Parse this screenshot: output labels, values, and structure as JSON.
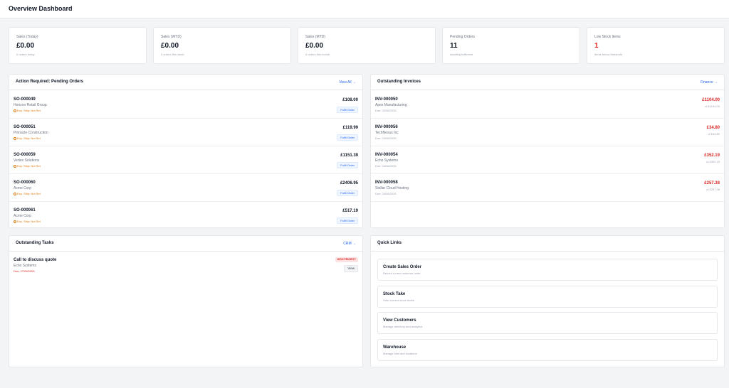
{
  "header": {
    "title": "Overview Dashboard"
  },
  "stats": [
    {
      "label": "Sales (Today)",
      "value": "£0.00",
      "sub": "0 orders today"
    },
    {
      "label": "Sales (WTD)",
      "value": "£0.00",
      "sub": "0 orders this week"
    },
    {
      "label": "Sales (MTD)",
      "value": "£0.00",
      "sub": "0 orders this month"
    },
    {
      "label": "Pending Orders",
      "value": "11",
      "sub": "Awaiting fulfilment"
    },
    {
      "label": "Low Stock Items",
      "value": "1",
      "sub": "Items below threshold"
    }
  ],
  "pending": {
    "title": "Action Required: Pending Orders",
    "link": "View All →",
    "rows": [
      {
        "id": "SO-000049",
        "customer": "Horizon Retail Group",
        "warn": "Exp. Ship: Not Set",
        "amount": "£108.00",
        "button": "Fulfil Order"
      },
      {
        "id": "SO-000051",
        "customer": "Pinnacle Construction",
        "warn": "Exp. Ship: Not Set",
        "amount": "£119.99",
        "button": "Fulfil Order"
      },
      {
        "id": "SO-000059",
        "customer": "Vertex Solutions",
        "warn": "Exp. Ship: Not Set",
        "amount": "£1151.39",
        "button": "Fulfil Order"
      },
      {
        "id": "SO-000060",
        "customer": "Acme Corp",
        "warn": "Exp. Ship: Not Set",
        "amount": "£2406.95",
        "button": "Fulfil Order"
      },
      {
        "id": "SO-000061",
        "customer": "Acme Corp",
        "warn": "Exp. Ship: Not Set",
        "amount": "£517.19",
        "button": "Fulfil Order"
      }
    ]
  },
  "invoices": {
    "title": "Outstanding Invoices",
    "link": "Finance →",
    "rows": [
      {
        "id": "INV-000050",
        "customer": "Apex Manufacturing",
        "due": "Due: 20/06/2026",
        "amount": "£1104.00",
        "of": "of £1104.00"
      },
      {
        "id": "INV-000056",
        "customer": "TechNexus Inc",
        "due": "Due: 24/06/2026",
        "amount": "£34.80",
        "of": "of £34.80"
      },
      {
        "id": "INV-000054",
        "customer": "Echo Systems",
        "due": "Due: 24/06/2026",
        "amount": "£352.19",
        "of": "of £352.19"
      },
      {
        "id": "INV-000058",
        "customer": "Stellar Cloud Hosting",
        "due": "Due: 24/06/2026",
        "amount": "£257.38",
        "of": "of £257.38"
      }
    ]
  },
  "tasks": {
    "title": "Outstanding Tasks",
    "link": "CRM →",
    "items": [
      {
        "title": "Call to discuss quote",
        "who": "Echo Systems",
        "due": "Due: 27/05/2026",
        "badge": "HIGH PRIORITY",
        "button": "View"
      }
    ]
  },
  "quick_links": {
    "title": "Quick Links",
    "items": [
      {
        "title": "Create Sales Order",
        "desc": "Record a new customer order"
      },
      {
        "title": "Stock Take",
        "desc": "View current stock levels"
      },
      {
        "title": "View Customers",
        "desc": "Manage directory and analytics"
      },
      {
        "title": "Warehouse",
        "desc": "Manage bins and locations"
      }
    ]
  },
  "colors": {
    "accent": "#2563eb",
    "danger": "#dc2626",
    "warning": "#d97706"
  }
}
